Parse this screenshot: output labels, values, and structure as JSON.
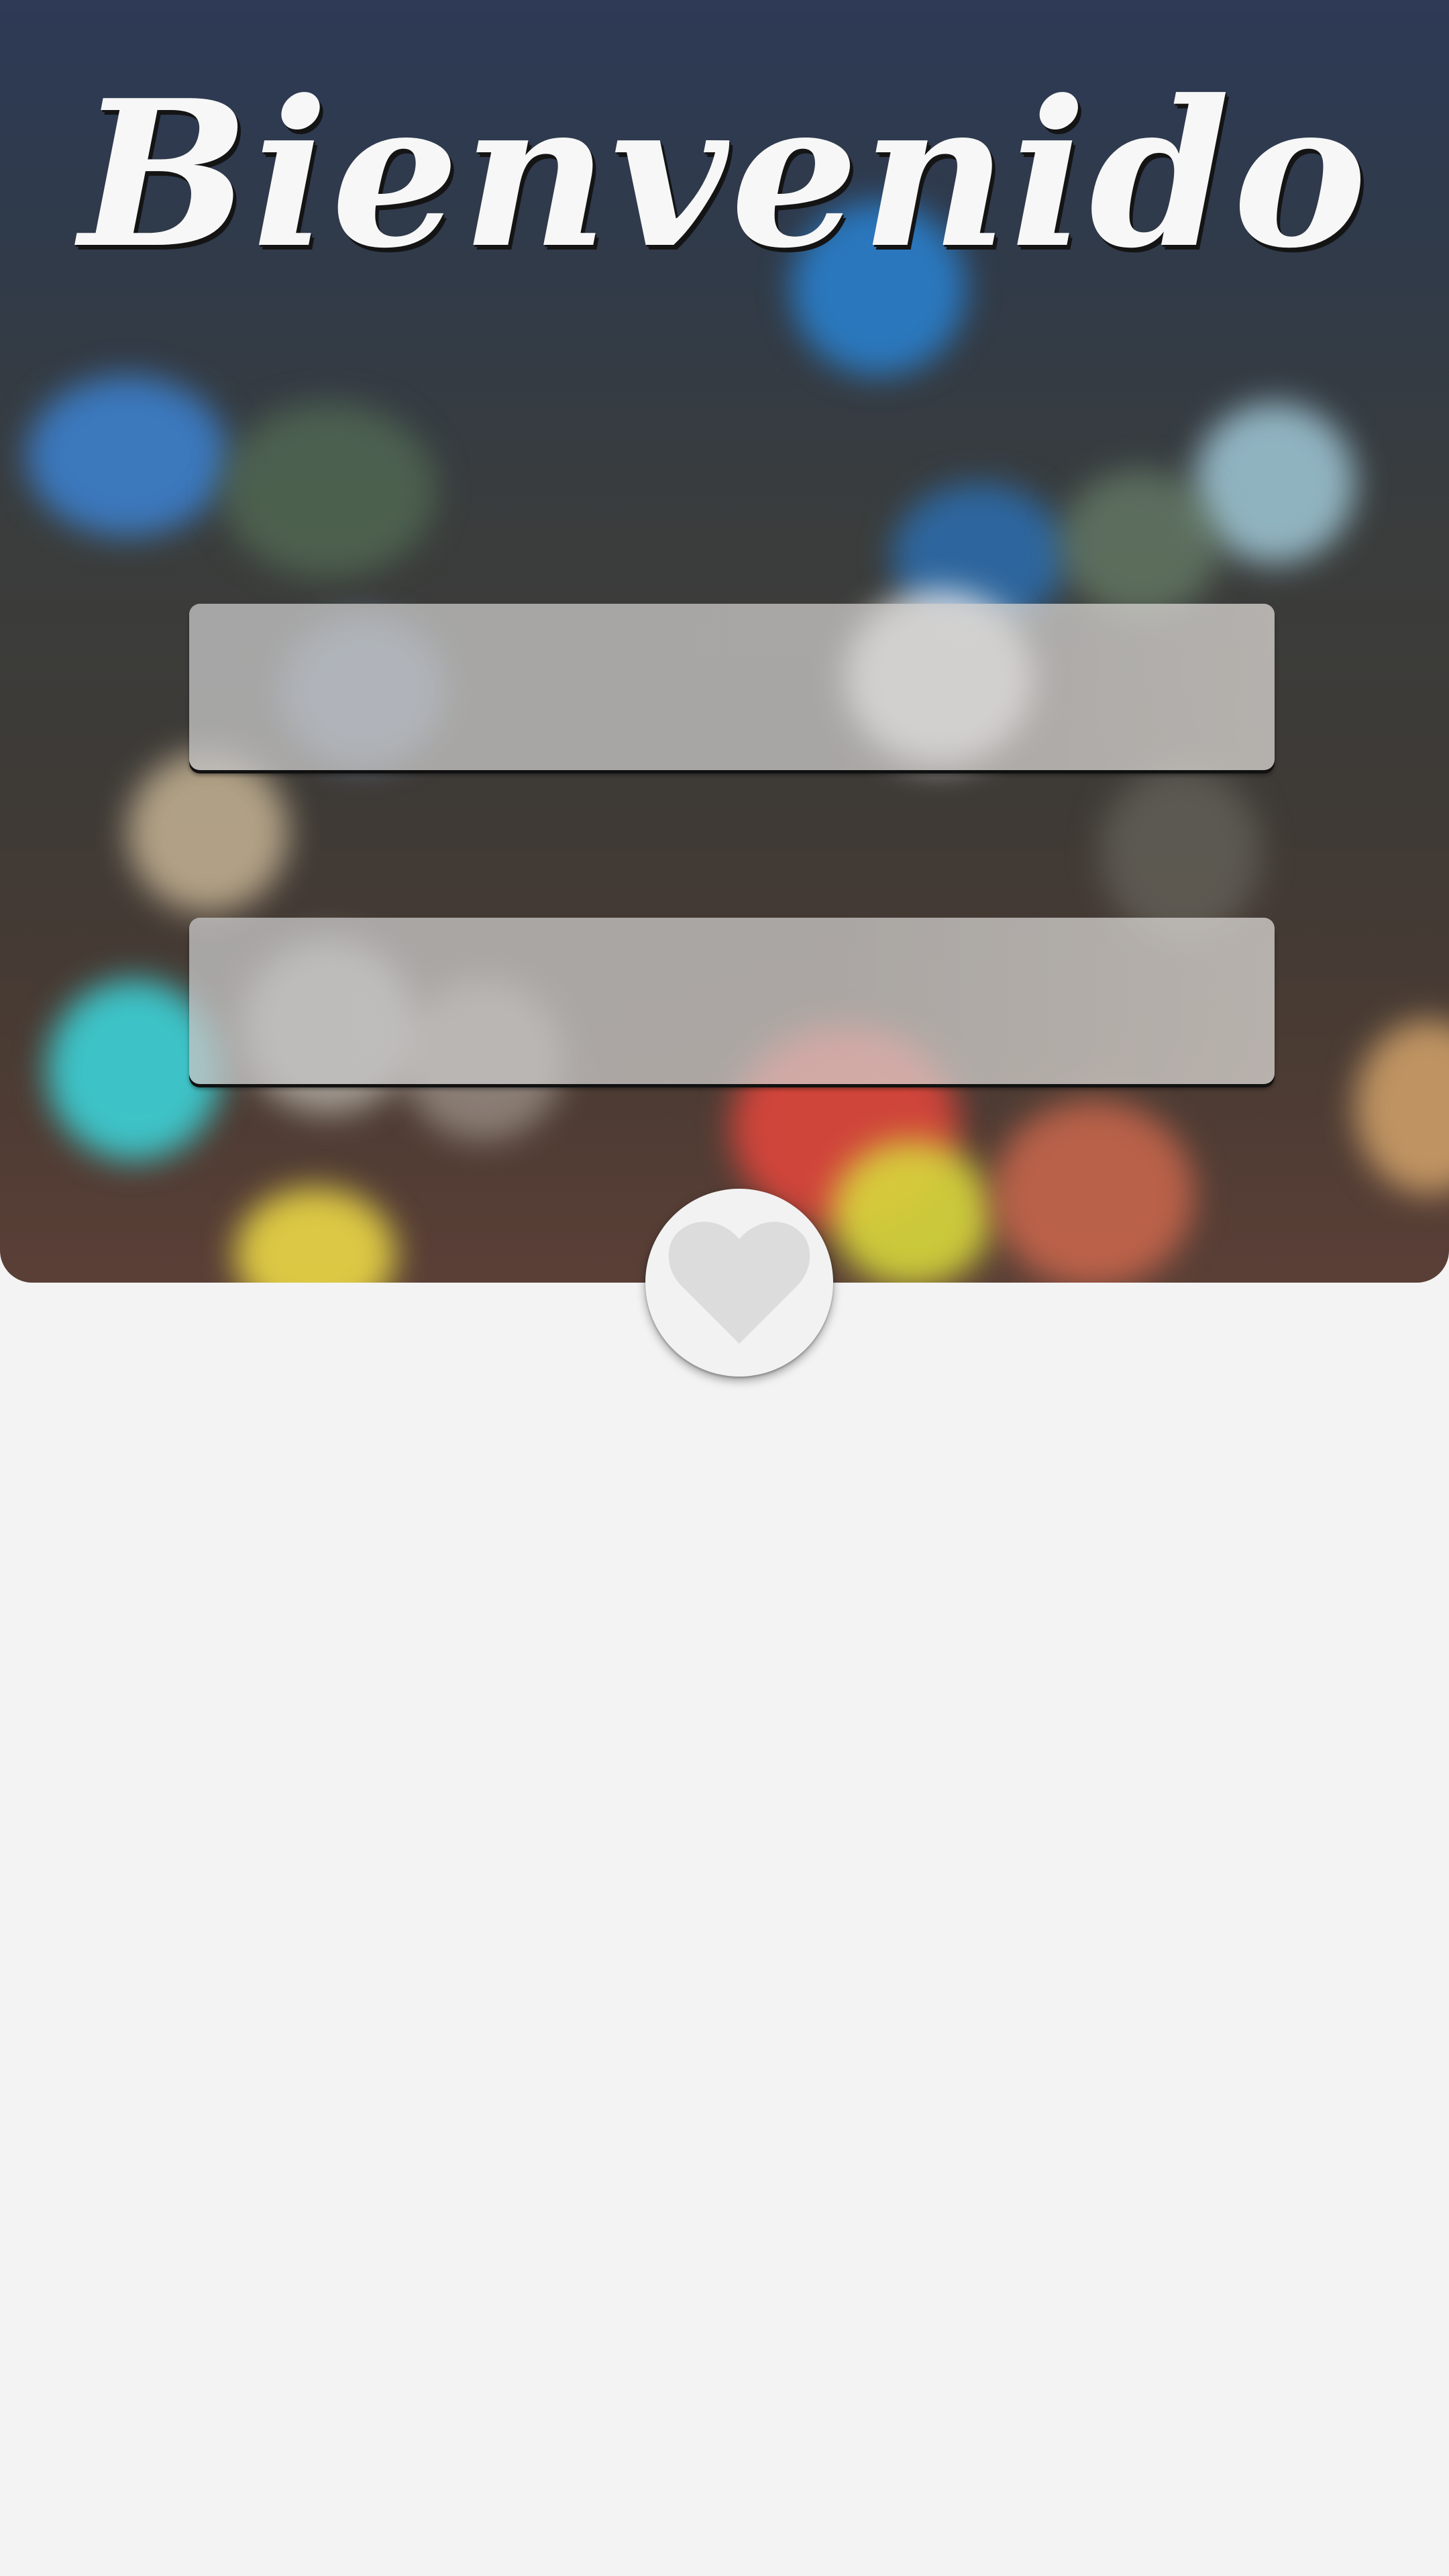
{
  "screen": {
    "title": "Bienvenido"
  },
  "form": {
    "field_one": {
      "value": "",
      "placeholder": ""
    },
    "field_two": {
      "value": "",
      "placeholder": ""
    }
  },
  "actions": {
    "submit_icon": "heart-icon"
  },
  "colors": {
    "background": "#f3f3f3",
    "title_text": "#f7f7f7",
    "button_bg": "#f2f2f2",
    "heart": "#dcdcdc"
  }
}
